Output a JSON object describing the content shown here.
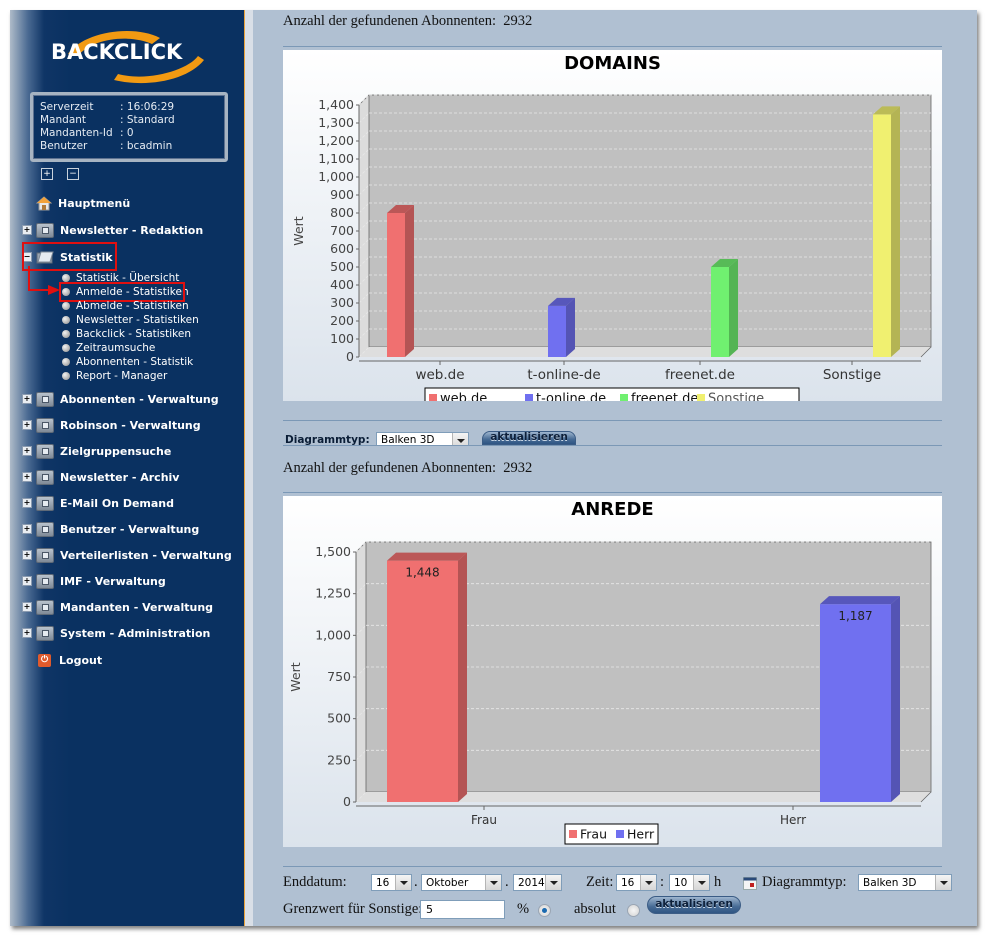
{
  "app": {
    "logo_text": "BACKCLICK"
  },
  "server_info": [
    {
      "key": "Serverzeit",
      "value": "16:06:29"
    },
    {
      "key": "Mandant",
      "value": "Standard"
    },
    {
      "key": "Mandanten-Id",
      "value": "0"
    },
    {
      "key": "Benutzer",
      "value": "bcadmin"
    }
  ],
  "tree_controls": {
    "expand": "+",
    "collapse": "−"
  },
  "sidebar": {
    "home_label": "Hauptmenü",
    "items_top": [
      {
        "label": "Newsletter - Redaktion",
        "state": "collapsed"
      },
      {
        "label": "Statistik",
        "state": "expanded",
        "highlighted": true
      }
    ],
    "statistik_children": [
      {
        "label": "Statistik - Übersicht"
      },
      {
        "label": "Anmelde - Statistiken",
        "active": true
      },
      {
        "label": "Abmelde - Statistiken"
      },
      {
        "label": "Newsletter - Statistiken"
      },
      {
        "label": "Backclick - Statistiken"
      },
      {
        "label": "Zeitraumsuche"
      },
      {
        "label": "Abonnenten - Statistik"
      },
      {
        "label": "Report - Manager"
      }
    ],
    "items_bottom": [
      {
        "label": "Abonnenten - Verwaltung"
      },
      {
        "label": "Robinson - Verwaltung"
      },
      {
        "label": "Zielgruppensuche"
      },
      {
        "label": "Newsletter - Archiv"
      },
      {
        "label": "E-Mail On Demand"
      },
      {
        "label": "Benutzer - Verwaltung"
      },
      {
        "label": "Verteilerlisten - Verwaltung"
      },
      {
        "label": "IMF - Verwaltung"
      },
      {
        "label": "Mandanten - Verwaltung"
      },
      {
        "label": "System - Administration"
      }
    ],
    "logout_label": "Logout"
  },
  "section1": {
    "count_label": "Anzahl der gefundenen Abonnenten:",
    "count_value": "2932",
    "diagrammtyp_label": "Diagrammtyp:",
    "diagrammtyp_value": "Balken 3D",
    "update_button": "aktualisieren"
  },
  "section2": {
    "count_label": "Anzahl der gefundenen Abonnenten:",
    "count_value": "2932"
  },
  "controls": {
    "enddatum_label": "Enddatum:",
    "day": "16",
    "month": "Oktober",
    "year": "2014",
    "zeit_label": "Zeit:",
    "hour": "16",
    "minute": "10",
    "hour_suffix": "h",
    "diagrammtyp_label": "Diagrammtyp:",
    "diagrammtyp_value": "Balken 3D",
    "grenzwert_label": "Grenzwert für Sonstige:",
    "grenzwert_value": "5",
    "percent_label": "%",
    "absolut_label": "absolut",
    "mode_selected": "percent",
    "update_button": "aktualisieren",
    "date_separator": ".",
    "time_separator": ":"
  },
  "chart_data": [
    {
      "type": "bar",
      "title": "DOMAINS",
      "xlabel": "",
      "ylabel": "Wert",
      "ylim": [
        0,
        1400
      ],
      "yticks": [
        0,
        100,
        200,
        300,
        400,
        500,
        600,
        700,
        800,
        900,
        1000,
        1100,
        1200,
        1300,
        1400
      ],
      "ytick_labels": [
        "0",
        "100",
        "200",
        "300",
        "400",
        "500",
        "600",
        "700",
        "800",
        "900",
        "1,000",
        "1,100",
        "1,200",
        "1,300",
        "1,400"
      ],
      "categories": [
        "web.de",
        "t-online-de",
        "freenet.de",
        "Sonstige"
      ],
      "values": [
        800,
        284,
        500,
        1348
      ],
      "colors": [
        "#f07070",
        "#7070f0",
        "#70f070",
        "#f0f070"
      ],
      "legend": [
        "web.de",
        "t-online.de",
        "freenet.de",
        "Sonstige"
      ],
      "legend_position": "bottom",
      "grid": true,
      "style": "3d"
    },
    {
      "type": "bar",
      "title": "ANREDE",
      "xlabel": "",
      "ylabel": "Wert",
      "ylim": [
        0,
        1500
      ],
      "yticks": [
        0,
        250,
        500,
        750,
        1000,
        1250,
        1500
      ],
      "ytick_labels": [
        "0",
        "250",
        "500",
        "750",
        "1,000",
        "1,250",
        "1,500"
      ],
      "categories": [
        "Frau",
        "Herr"
      ],
      "values": [
        1448,
        1187
      ],
      "value_labels": [
        "1,448",
        "1,187"
      ],
      "colors": [
        "#f07070",
        "#7070f0"
      ],
      "legend": [
        "Frau",
        "Herr"
      ],
      "legend_position": "bottom",
      "grid": true,
      "style": "3d"
    }
  ]
}
